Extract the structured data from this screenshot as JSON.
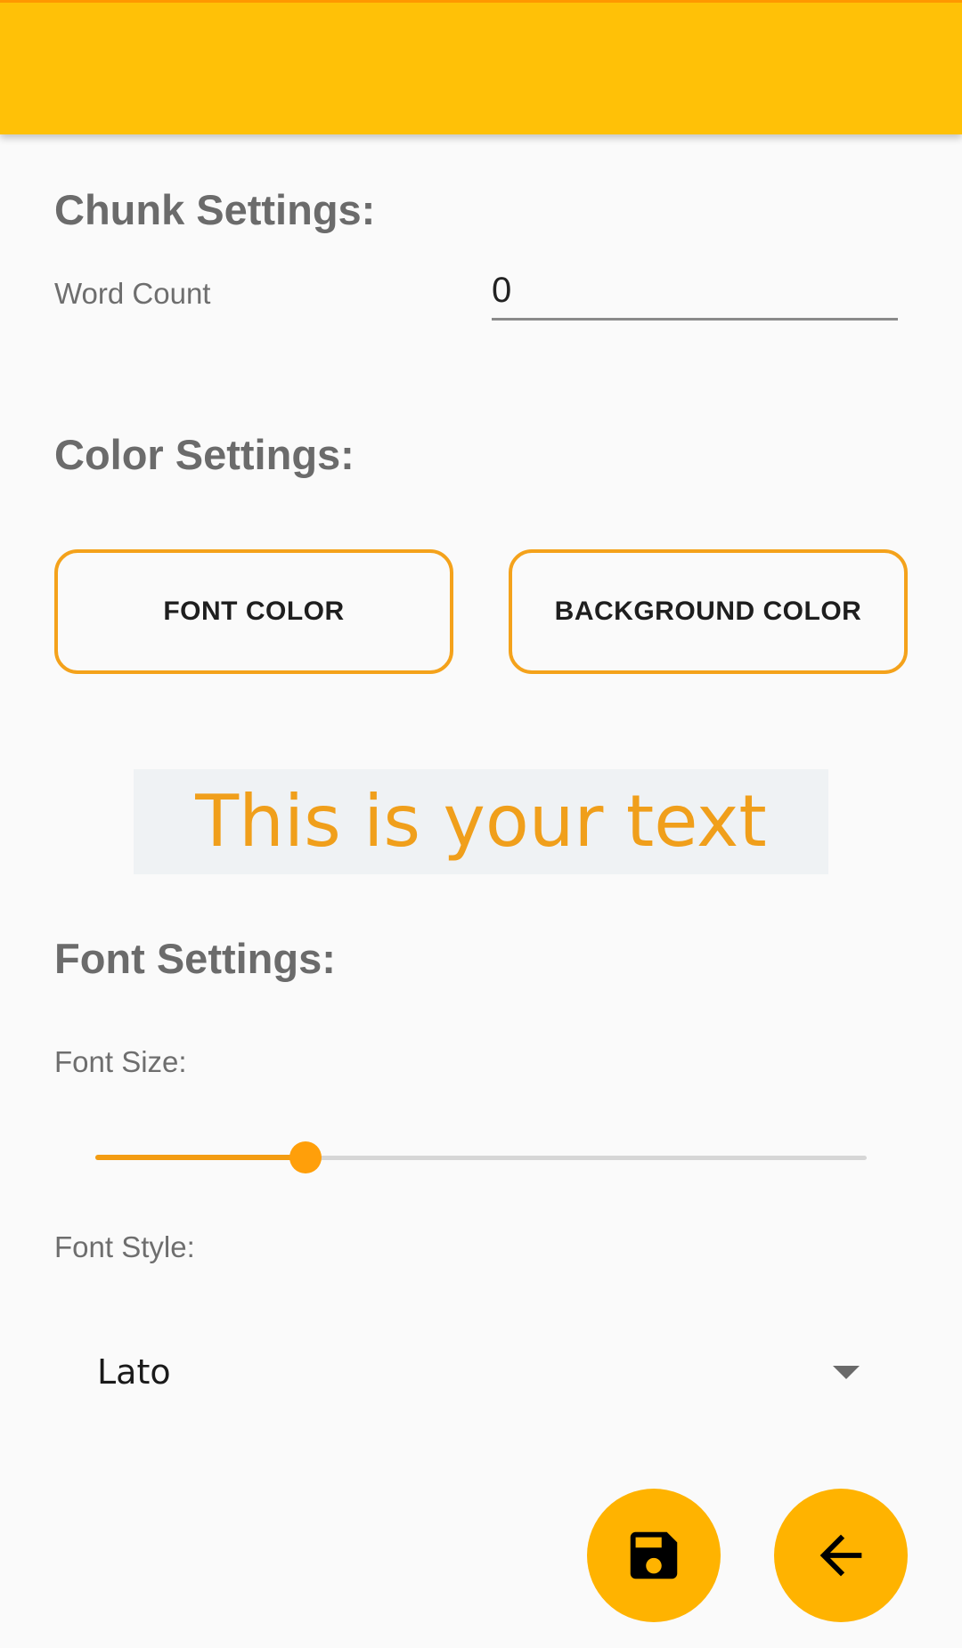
{
  "colors": {
    "app_bar": "#ffc107",
    "accent": "#f4a21b",
    "preview_text": "#f09f1b",
    "preview_background": "#eff2f4",
    "fab": "#ffb300"
  },
  "chunk_settings": {
    "title": "Chunk Settings:",
    "word_count_label": "Word Count",
    "word_count_value": "0"
  },
  "color_settings": {
    "title": "Color Settings:",
    "font_color_button": "FONT COLOR",
    "background_color_button": "BACKGROUND COLOR"
  },
  "preview": {
    "text": "This is your text"
  },
  "font_settings": {
    "title": "Font Settings:",
    "font_size_label": "Font Size:",
    "font_size_fraction": 0.273,
    "font_style_label": "Font Style:",
    "font_style_value": "Lato"
  },
  "fabs": {
    "save_icon": "save-icon",
    "back_icon": "arrow-back-icon"
  }
}
